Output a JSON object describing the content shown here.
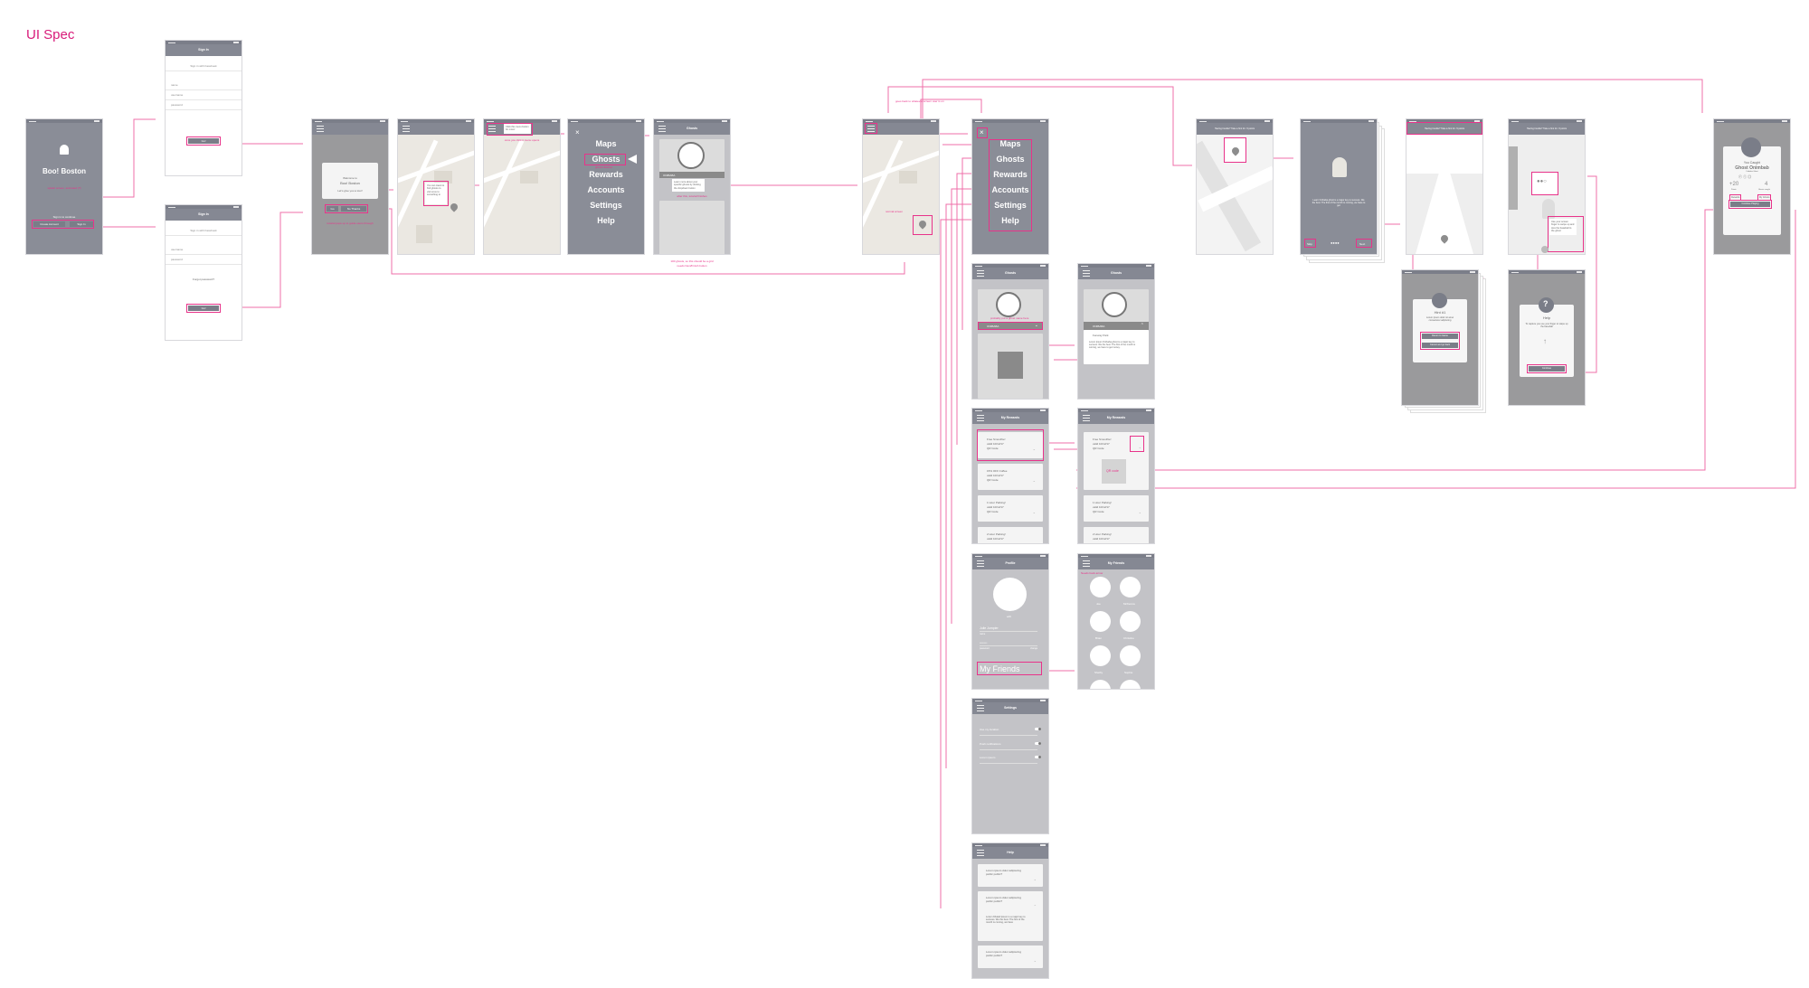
{
  "spec_title": "UI Spec",
  "colors": {
    "annotation": "#e8338a",
    "screen": "#8a8d97"
  },
  "splash": {
    "title": "Boo! Boston",
    "note": "splash screen, animated (?)",
    "prompt": "Sign in to continue",
    "create": "Create Account",
    "signin": "Sign In"
  },
  "signin": {
    "header": "Sign In",
    "facebook": "Sign in with Facebook",
    "name": "name",
    "username": "username",
    "password": "password",
    "go": "Go!",
    "forgot": "Forgot password?"
  },
  "welcome": {
    "line1": "Welcome to",
    "line2": "Boo! Boston",
    "prompt": "Let's give you a tour!",
    "go": "Go",
    "no": "No Thanks",
    "note": "tutorial pops up to guide users through"
  },
  "map1": {
    "tip": "You can travel to find ghosts to visit once to something to"
  },
  "map2": {
    "tip": "Click this menu button for more!",
    "note": "once you click it menu opens"
  },
  "menu": {
    "items": [
      "Maps",
      "Ghosts",
      "Rewards",
      "Accounts",
      "Settings",
      "Help"
    ],
    "close": "×",
    "note": "ghosts flashes"
  },
  "onboard": {
    "header": "Ghosts",
    "label": "ONIBABA",
    "tip": "Learn more about your specific ghosts by clicking the dropdown button",
    "note": "after this, tutorial finishes",
    "bottom1": "100 ghosts, so this should be a grid",
    "bottom2": "needs Next/Finish button"
  },
  "main_map": {
    "note": "normal screen",
    "back_note": "goes back to whatever screen user is on"
  },
  "ghosts": {
    "header": "Ghosts",
    "label": "ONIBABA",
    "note": "probably put a ghost name here",
    "place": "Fenway Park",
    "desc": "Lorem Ipsum Onibaba ghost is a major key to success. We the best. The first of the month is coming, we have to get money."
  },
  "rewards": {
    "header": "My Rewards",
    "items": [
      {
        "name": "Free Smoothie!",
        "valid": "valid 10/12/17",
        "code": "QR Code"
      },
      {
        "name": "15% OFF Coffee",
        "valid": "valid 10/12/17",
        "code": "QR Code"
      },
      {
        "name": "1 Hour Parking!",
        "valid": "valid 10/12/17",
        "code": "QR Code"
      },
      {
        "name": "2 Hour Parking!",
        "valid": "valid 10/12/17",
        "code": "QR Code"
      }
    ],
    "qr": "QR code"
  },
  "profile": {
    "header": "Profile",
    "edit": "edit",
    "name": "Julie Jumpier",
    "name_label": "name",
    "password": "••••••••",
    "password_label": "password",
    "change": "change",
    "friends": "My Friends"
  },
  "friends": {
    "header": "My Friends",
    "note": "Needs back arrow",
    "names": [
      "Joe",
      "McKenna",
      "Brian",
      "Christine",
      "Shelby",
      "Sophie"
    ]
  },
  "settings": {
    "header": "Settings",
    "rows": [
      "Use my location",
      "Push notifications",
      "Lorem ipsum"
    ]
  },
  "help": {
    "header": "Help",
    "question": "Lorem ipsum dolor adipiscing public public?",
    "answer": "Lorem Khaled Ipsum is a major key to success. We the best. The first of the month is coming, we have"
  },
  "ar": {
    "header": "Having trouble? Take a hint for -5 points",
    "catch_tip": "Use your screen finger to swipe up and toss the baseball to the ghost"
  },
  "tutorial": {
    "text": "Learn Onibaba ghost is a major key to success. We the best. The first of the month is coming, we have to get",
    "skip": "Skip",
    "next": "Next"
  },
  "hint": {
    "title": "Hint #1",
    "text": "Lorem ipsum dolor sit amet consectetur adipiscing",
    "ret": "Return to Game",
    "cancel": "Cancel and go back"
  },
  "help_popup": {
    "title": "Help",
    "text": "To capture you use your finger to swipe up the baseball",
    "btn": "Continue"
  },
  "caught": {
    "line1": "You Caught",
    "name": "Ghost Onimbab",
    "sub": "Onibaba Ghost",
    "points": "+20",
    "points_label": "Points",
    "count": "4",
    "count_label": "Ghosts caught",
    "rewards": "Rewards",
    "my_ghosts": "My Ghosts",
    "continue": "Continue Playing"
  }
}
